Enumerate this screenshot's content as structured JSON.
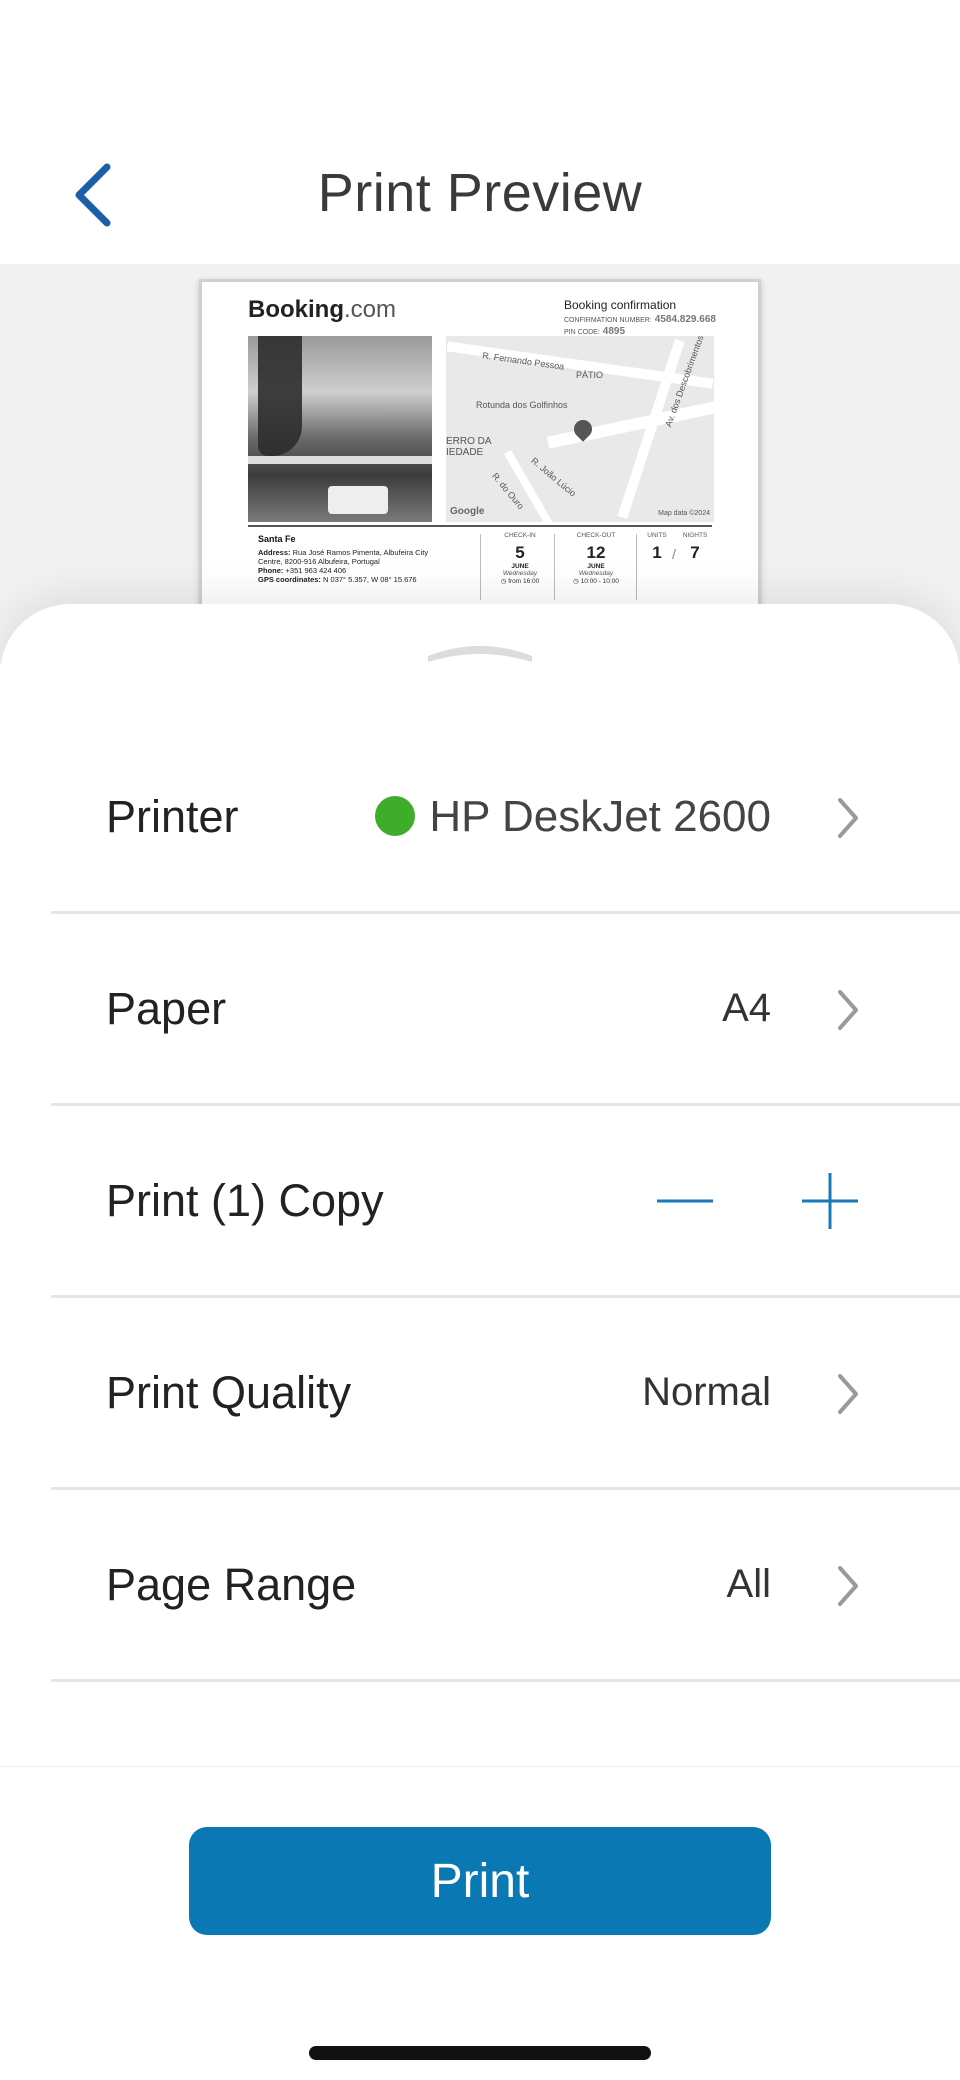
{
  "header": {
    "title": "Print Preview",
    "back_icon": "chevron-left-icon"
  },
  "preview": {
    "logo_main": "Booking",
    "logo_suffix": ".com",
    "conf_title": "Booking confirmation",
    "conf_number_label": "CONFIRMATION NUMBER:",
    "conf_number": "4584.829.668",
    "pin_label": "PIN CODE:",
    "pin": "4895",
    "map": {
      "street1": "R. Fernando Pessoa",
      "patio": "PÁTIO",
      "roundabout": "Rotunda dos Golfinhos",
      "avenue": "Av. dos Descobrimentos",
      "area1": "ERRO DA",
      "area2": "IEDADE",
      "street2": "R. João Lúcio",
      "street3": "R. do Ouro",
      "google": "Google",
      "mapdata": "Map data ©2024"
    },
    "hotel_name": "Santa Fe",
    "address_label": "Address:",
    "address": "Rua José Ramos Pimenta, Albufeira City Centre, 8200-916 Albufeira, Portugal",
    "phone_label": "Phone:",
    "phone": "+351 963 424 406",
    "gps_label": "GPS coordinates:",
    "gps": "N 037° 5.357, W 08° 15.676",
    "checkin": {
      "label": "CHECK-IN",
      "day": "5",
      "month": "JUNE",
      "weekday": "Wednesday",
      "time": "from 16:00"
    },
    "checkout": {
      "label": "CHECK-OUT",
      "day": "12",
      "month": "JUNE",
      "weekday": "Wednesday",
      "time": "10:00 - 10:00"
    },
    "units": {
      "label": "UNITS",
      "value": "1"
    },
    "nights": {
      "label": "NIGHTS",
      "value": "7"
    },
    "slash": "/"
  },
  "settings": {
    "printer": {
      "label": "Printer",
      "value": "HP DeskJet 2600",
      "status_color": "#3dad2a"
    },
    "paper": {
      "label": "Paper",
      "value": "A4"
    },
    "copies": {
      "label": "Print (1) Copy"
    },
    "quality": {
      "label": "Print Quality",
      "value": "Normal"
    },
    "range": {
      "label": "Page Range",
      "value": "All"
    }
  },
  "footer": {
    "print_label": "Print",
    "accent_color": "#0a78b3"
  }
}
